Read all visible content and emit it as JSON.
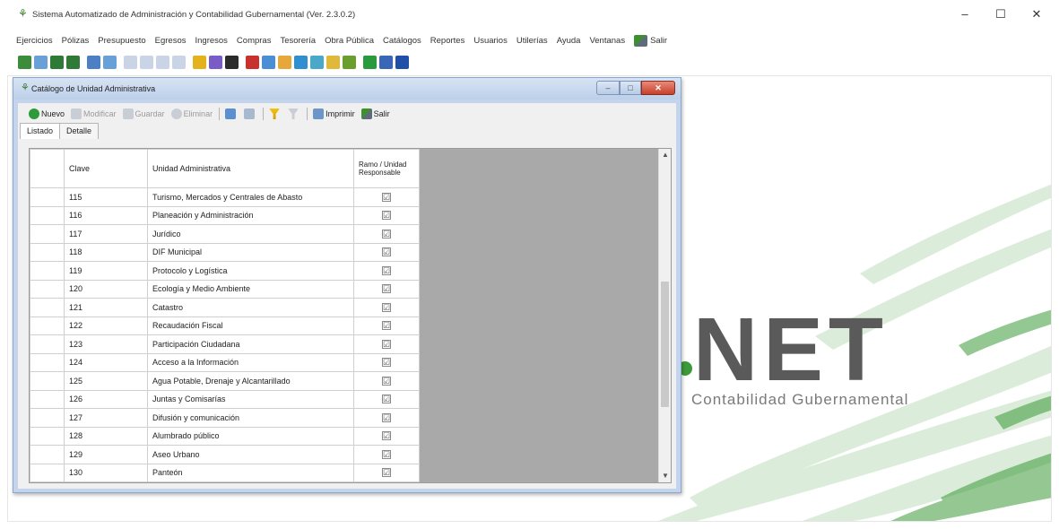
{
  "app": {
    "title": "Sistema Automatizado de Administración y Contabilidad Gubernamental (Ver. 2.3.0.2)",
    "window_controls": {
      "minimize": "–",
      "maximize": "☐",
      "close": "✕"
    }
  },
  "menu": {
    "items": [
      "Ejercicios",
      "Pólizas",
      "Presupuesto",
      "Egresos",
      "Ingresos",
      "Compras",
      "Tesorería",
      "Obra Pública",
      "Catálogos",
      "Reportes",
      "Usuarios",
      "Utilerías",
      "Ayuda",
      "Ventanas"
    ],
    "exit_label": "Salir"
  },
  "toolbar_icons": [
    "back-icon",
    "document-icon",
    "chart-icon",
    "money-icon",
    "calendar-icon",
    "grid-icon",
    "page-icon",
    "page-icon",
    "page-icon",
    "page-icon",
    "folder-icon",
    "pin-icon",
    "book-icon",
    "report-icon",
    "cubes-icon",
    "export-icon",
    "image-icon",
    "tools-icon",
    "archive-icon",
    "org-icon",
    "refresh-icon",
    "save-icon",
    "help-icon"
  ],
  "toolbar_colors": [
    "#3b8c3b",
    "#6aa0d8",
    "#2f7a36",
    "#2f7a36",
    "#4d7fc4",
    "#6aa0d8",
    "#c9d5e6",
    "#c9d5e6",
    "#c9d5e6",
    "#c9d5e6",
    "#e4b21d",
    "#7a5cc6",
    "#2b2b2b",
    "#c8312d",
    "#4a8fd6",
    "#e6a83a",
    "#2f8fd0",
    "#4aa8c8",
    "#e0b93a",
    "#6a9e2e",
    "#2a9b3c",
    "#3a66b8",
    "#1f4fa6"
  ],
  "child": {
    "title": "Catálogo de Unidad Administrativa",
    "buttons": {
      "minimize": "–",
      "maximize": "□",
      "close": "✕"
    },
    "toolbar": {
      "new": "Nuevo",
      "edit": "Modificar",
      "save": "Guardar",
      "delete": "Eliminar",
      "print": "Imprimir",
      "exit": "Salir"
    },
    "tabs": [
      "Listado",
      "Detalle"
    ],
    "grid": {
      "headers": {
        "clave": "Clave",
        "unidad": "Unidad Administrativa",
        "ramo": "Ramo / Unidad Responsable"
      },
      "rows": [
        {
          "clave": "115",
          "unidad": "Turismo, Mercados y Centrales de Abasto",
          "checked": "☑"
        },
        {
          "clave": "116",
          "unidad": "Planeación y Administración",
          "checked": "☑"
        },
        {
          "clave": "117",
          "unidad": "Jurídico",
          "checked": "☑"
        },
        {
          "clave": "118",
          "unidad": "DIF Municipal",
          "checked": "☑"
        },
        {
          "clave": "119",
          "unidad": "Protocolo y Logística",
          "checked": "☑"
        },
        {
          "clave": "120",
          "unidad": "Ecología y Medio Ambiente",
          "checked": "☑"
        },
        {
          "clave": "121",
          "unidad": "Catastro",
          "checked": "☑"
        },
        {
          "clave": "122",
          "unidad": "Recaudación Fiscal",
          "checked": "☑"
        },
        {
          "clave": "123",
          "unidad": "Participación Ciudadana",
          "checked": "☑"
        },
        {
          "clave": "124",
          "unidad": "Acceso a la Información",
          "checked": "☑"
        },
        {
          "clave": "125",
          "unidad": "Agua Potable, Drenaje y Alcantarillado",
          "checked": "☑"
        },
        {
          "clave": "126",
          "unidad": "Juntas y Comisarías",
          "checked": "☑"
        },
        {
          "clave": "127",
          "unidad": "Difusión y comunicación",
          "checked": "☑"
        },
        {
          "clave": "128",
          "unidad": "Alumbrado público",
          "checked": "☑"
        },
        {
          "clave": "129",
          "unidad": "Aseo Urbano",
          "checked": "☑"
        },
        {
          "clave": "130",
          "unidad": "Panteón",
          "checked": "☑"
        }
      ]
    }
  },
  "logo": {
    "mark": "NET",
    "subtitle": "Contabilidad Gubernamental"
  },
  "colors": {
    "logo_green": "#3d9a3a",
    "logo_gray": "#5a5a5a",
    "title_blue": "#bcd0ea",
    "close_red": "#c6412b"
  }
}
